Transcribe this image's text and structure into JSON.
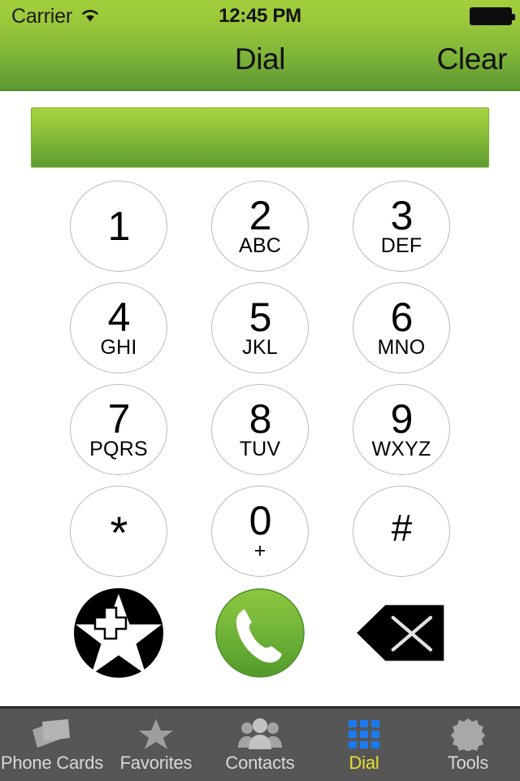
{
  "status_bar": {
    "carrier": "Carrier",
    "wifi_icon": "wifi-icon",
    "time": "12:45 PM",
    "battery_icon": "battery-full-icon"
  },
  "nav_bar": {
    "title": "Dial",
    "clear_label": "Clear"
  },
  "display": {
    "value": "",
    "placeholder": ""
  },
  "keypad": {
    "keys": [
      {
        "digit": "1",
        "letters": ""
      },
      {
        "digit": "2",
        "letters": "ABC"
      },
      {
        "digit": "3",
        "letters": "DEF"
      },
      {
        "digit": "4",
        "letters": "GHI"
      },
      {
        "digit": "5",
        "letters": "JKL"
      },
      {
        "digit": "6",
        "letters": "MNO"
      },
      {
        "digit": "7",
        "letters": "PQRS"
      },
      {
        "digit": "8",
        "letters": "TUV"
      },
      {
        "digit": "9",
        "letters": "WXYZ"
      },
      {
        "digit": "*",
        "letters": ""
      },
      {
        "digit": "0",
        "letters": "+"
      },
      {
        "digit": "#",
        "letters": ""
      }
    ]
  },
  "actions": {
    "add_favorite_icon": "star-plus-icon",
    "call_icon": "phone-handset-icon",
    "backspace_icon": "backspace-delete-icon"
  },
  "tab_bar": {
    "active_index": 3,
    "tabs": [
      {
        "label": "Phone Cards",
        "icon": "phone-cards-icon"
      },
      {
        "label": "Favorites",
        "icon": "star-icon"
      },
      {
        "label": "Contacts",
        "icon": "contacts-icon"
      },
      {
        "label": "Dial",
        "icon": "keypad-grid-icon"
      },
      {
        "label": "Tools",
        "icon": "gear-icon"
      }
    ]
  },
  "colors": {
    "brand_green_light": "#a3cf3c",
    "brand_green_dark": "#5d9a33",
    "call_green": "#6cb43a",
    "tab_bar_bg": "#565656",
    "tab_active_text": "#e8e033",
    "tab_active_icon": "#1a7bf0",
    "tab_inactive": "#d8d8d8"
  }
}
